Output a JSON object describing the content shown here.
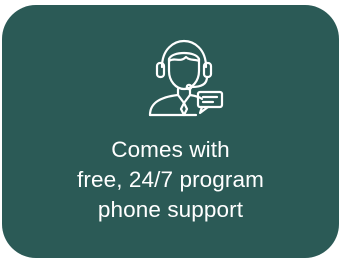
{
  "card": {
    "background": "#2b5a56",
    "icon": "support-agent-headset-chat-icon",
    "text_lines": [
      "Comes with",
      "free, 24/7 program",
      "phone support"
    ]
  }
}
